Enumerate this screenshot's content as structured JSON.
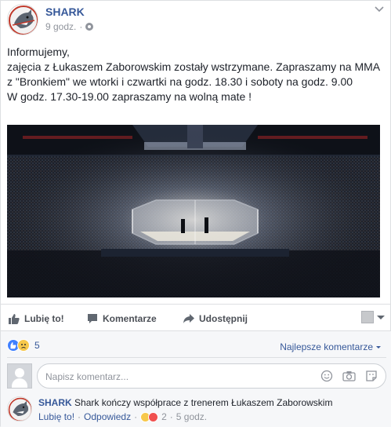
{
  "post": {
    "page_name": "SHARK",
    "time": "9 godz.",
    "separator": "·",
    "text_lines": [
      "Informujemy,",
      "zajęcia z Łukaszem Zaborowskim zostały wstrzymane. Zapraszamy na MMA z \"Bronkiem\" we wtorki i czwartki na godz. 18.30 i soboty na godz. 9.00",
      "W godz. 17.30-19.00 zapraszamy na wolną mate !"
    ]
  },
  "actions": {
    "like_label": "Lubię to!",
    "comment_label": "Komentarze",
    "share_label": "Udostępnij"
  },
  "reactions": {
    "count": "5",
    "sort_label": "Najlepsze komentarze"
  },
  "comment_input": {
    "placeholder": "Napisz komentarz..."
  },
  "comment": {
    "author": "SHARK",
    "text": "Shark kończy współprace z trenerem Łukaszem Zaborowskim",
    "like_label": "Lubię to!",
    "reply_label": "Odpowiedz",
    "separator": "·",
    "reaction_count": "2",
    "time": "5 godz."
  },
  "colors": {
    "link": "#365899",
    "like_reaction": "#4080ff",
    "sad_reaction": "#f7c84b",
    "haha_reaction": "#f0504f"
  }
}
